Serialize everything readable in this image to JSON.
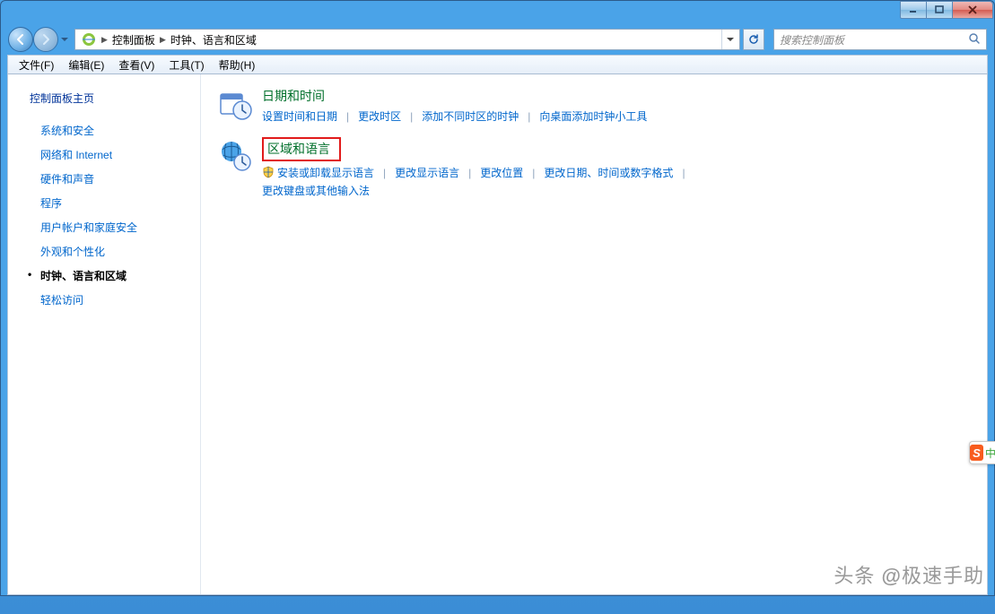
{
  "caption_buttons": {
    "min": "minimize",
    "max": "maximize",
    "close": "close"
  },
  "breadcrumb": {
    "root_icon": "control-panel",
    "items": [
      "控制面板",
      "时钟、语言和区域"
    ]
  },
  "search": {
    "placeholder": "搜索控制面板"
  },
  "menu": {
    "file": "文件(F)",
    "edit": "编辑(E)",
    "view": "查看(V)",
    "tools": "工具(T)",
    "help": "帮助(H)"
  },
  "sidebar": {
    "heading": "控制面板主页",
    "items": [
      {
        "label": "系统和安全"
      },
      {
        "label": "网络和 Internet"
      },
      {
        "label": "硬件和声音"
      },
      {
        "label": "程序"
      },
      {
        "label": "用户帐户和家庭安全"
      },
      {
        "label": "外观和个性化"
      },
      {
        "label": "时钟、语言和区域",
        "active": true
      },
      {
        "label": "轻松访问"
      }
    ]
  },
  "content": {
    "datetime": {
      "title": "日期和时间",
      "tasks": [
        "设置时间和日期",
        "更改时区",
        "添加不同时区的时钟",
        "向桌面添加时钟小工具"
      ]
    },
    "region": {
      "title": "区域和语言",
      "tasks_row1": [
        {
          "label": "安装或卸载显示语言",
          "shield": true
        },
        {
          "label": "更改显示语言"
        },
        {
          "label": "更改位置"
        },
        {
          "label": "更改日期、时间或数字格式"
        }
      ],
      "tasks_row2": [
        {
          "label": "更改键盘或其他输入法"
        }
      ]
    }
  },
  "watermark": {
    "prefix": "头条 ",
    "at": "@",
    "name": "极速手助"
  },
  "ime": {
    "s": "S",
    "c": "中"
  }
}
